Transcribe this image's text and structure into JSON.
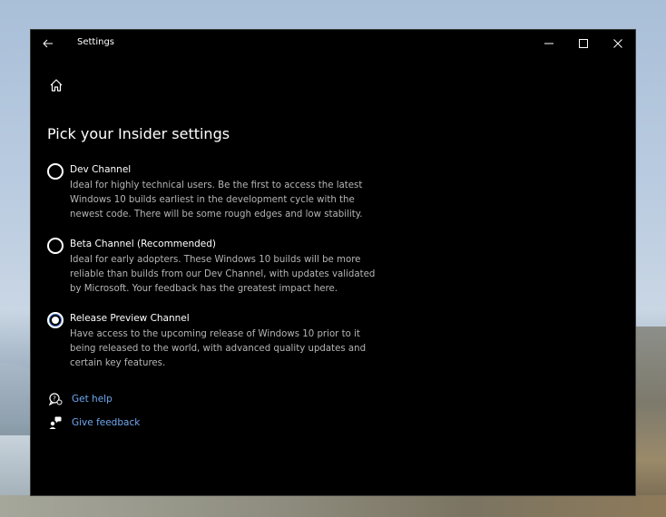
{
  "window": {
    "title": "Settings"
  },
  "page": {
    "title": "Pick your Insider settings"
  },
  "options": [
    {
      "label": "Dev Channel",
      "description": "Ideal for highly technical users. Be the first to access the latest Windows 10 builds earliest in the development cycle with the newest code. There will be some rough edges and low stability.",
      "selected": false
    },
    {
      "label": "Beta Channel (Recommended)",
      "description": "Ideal for early adopters. These Windows 10 builds will be more reliable than builds from our Dev Channel, with updates validated by Microsoft. Your feedback has the greatest impact here.",
      "selected": false
    },
    {
      "label": "Release Preview Channel",
      "description": "Have access to the upcoming release of Windows 10 prior to it being released to the world, with advanced quality updates and certain key features.",
      "selected": true
    }
  ],
  "links": [
    {
      "label": "Get help",
      "icon": "help-chat-icon"
    },
    {
      "label": "Give feedback",
      "icon": "feedback-icon"
    }
  ],
  "colors": {
    "accent_link": "#6fa8f0",
    "window_bg": "#000000",
    "description_text": "#b5b5b5",
    "radio_selected_ring": "#3b6fd6"
  }
}
